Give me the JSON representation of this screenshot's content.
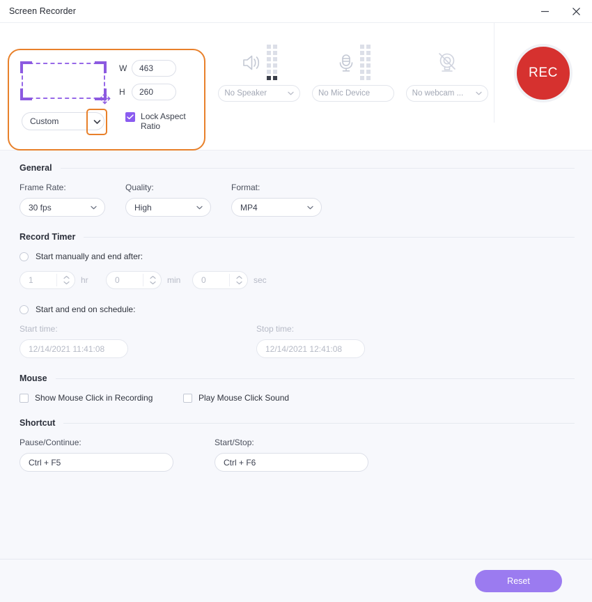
{
  "window": {
    "title": "Screen Recorder",
    "minimize_icon": "minimize-icon",
    "close_icon": "close-icon"
  },
  "capture": {
    "region_graphic": "region-selection-icon",
    "move_handle_icon": "move-handle-icon",
    "width_label": "W",
    "width_value": "463",
    "height_label": "H",
    "height_value": "260",
    "preset": "Custom",
    "preset_caret_icon": "chevron-down-icon",
    "lock_aspect_label": "Lock Aspect Ratio",
    "lock_aspect_checked": true,
    "highlight_color": "#e8802a",
    "selection_color": "#8c5ae0"
  },
  "devices": [
    {
      "icon": "speaker-icon",
      "has_meter": true,
      "value": "No Speaker",
      "caret_icon": "chevron-down-icon",
      "has_caret": true
    },
    {
      "icon": "microphone-icon",
      "has_meter": true,
      "value": "No Mic Device",
      "caret_icon": "chevron-down-icon",
      "has_caret": false
    },
    {
      "icon": "webcam-disabled-icon",
      "has_meter": false,
      "value": "No webcam ...",
      "caret_icon": "chevron-down-icon",
      "has_caret": true
    }
  ],
  "record": {
    "label": "REC",
    "color": "#d6312f"
  },
  "toolbar": {
    "screen_icon": "screen-capture-icon",
    "settings_icon": "settings-gear-icon",
    "expand_icon": "chevron-up-icon"
  },
  "general": {
    "title": "General",
    "frame_rate_label": "Frame Rate:",
    "frame_rate_value": "30 fps",
    "quality_label": "Quality:",
    "quality_value": "High",
    "format_label": "Format:",
    "format_value": "MP4"
  },
  "record_timer": {
    "title": "Record Timer",
    "manual_option": "Start manually and end after:",
    "manual_selected": false,
    "hr_value": "1",
    "hr_unit": "hr",
    "min_value": "0",
    "min_unit": "min",
    "sec_value": "0",
    "sec_unit": "sec",
    "schedule_option": "Start and end on schedule:",
    "schedule_selected": false,
    "start_time_label": "Start time:",
    "start_time_value": "12/14/2021 11:41:08",
    "stop_time_label": "Stop time:",
    "stop_time_value": "12/14/2021 12:41:08"
  },
  "mouse": {
    "title": "Mouse",
    "show_click_label": "Show Mouse Click in Recording",
    "show_click_checked": false,
    "play_sound_label": "Play Mouse Click Sound",
    "play_sound_checked": false
  },
  "shortcut": {
    "title": "Shortcut",
    "pause_label": "Pause/Continue:",
    "pause_value": "Ctrl + F5",
    "start_label": "Start/Stop:",
    "start_value": "Ctrl + F6"
  },
  "footer": {
    "reset_label": "Reset",
    "reset_color": "#9b7bf0"
  }
}
